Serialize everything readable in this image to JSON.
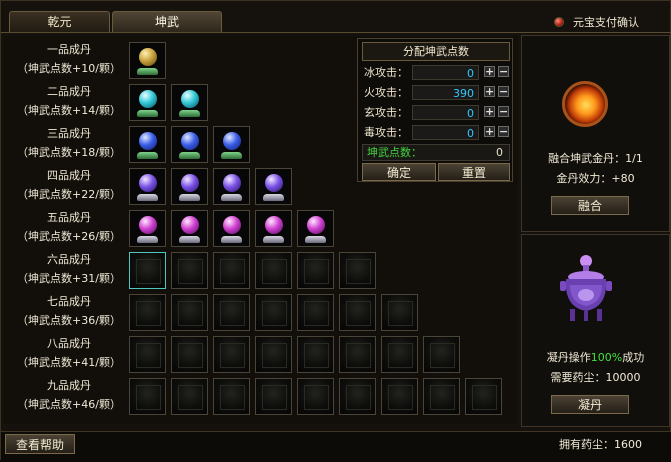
{
  "tabs": {
    "qianyuan": "乾元",
    "kunwu": "坤武"
  },
  "pay": {
    "label": "元宝支付确认",
    "checked": false
  },
  "rows": [
    {
      "name": "一品成丹",
      "sub": "（坤武点数+10/颗）",
      "filled": 1,
      "total": 1,
      "orb": "gold",
      "pedestal": "green"
    },
    {
      "name": "二品成丹",
      "sub": "（坤武点数+14/颗）",
      "filled": 2,
      "total": 2,
      "orb": "cyan",
      "pedestal": "green"
    },
    {
      "name": "三品成丹",
      "sub": "（坤武点数+18/颗）",
      "filled": 3,
      "total": 3,
      "orb": "blue",
      "pedestal": "green"
    },
    {
      "name": "四品成丹",
      "sub": "（坤武点数+22/颗）",
      "filled": 4,
      "total": 4,
      "orb": "violet",
      "pedestal": "silver"
    },
    {
      "name": "五品成丹",
      "sub": "（坤武点数+26/颗）",
      "filled": 5,
      "total": 5,
      "orb": "pink",
      "pedestal": "silver"
    },
    {
      "name": "六品成丹",
      "sub": "（坤武点数+31/颗）",
      "filled": 0,
      "total": 6,
      "orb": "",
      "pedestal": ""
    },
    {
      "name": "七品成丹",
      "sub": "（坤武点数+36/颗）",
      "filled": 0,
      "total": 7,
      "orb": "",
      "pedestal": ""
    },
    {
      "name": "八品成丹",
      "sub": "（坤武点数+41/颗）",
      "filled": 0,
      "total": 8,
      "orb": "",
      "pedestal": ""
    },
    {
      "name": "九品成丹",
      "sub": "（坤武点数+46/颗）",
      "filled": 0,
      "total": 9,
      "orb": "",
      "pedestal": ""
    }
  ],
  "distribution": {
    "title": "分配坤武点数",
    "attacks": [
      {
        "label": "冰攻击：",
        "value": "0"
      },
      {
        "label": "火攻击：",
        "value": "390"
      },
      {
        "label": "玄攻击：",
        "value": "0"
      },
      {
        "label": "毒攻击：",
        "value": "0"
      }
    ],
    "plus": "+",
    "minus": "−",
    "points_label": "坤武点数：",
    "points_value": "0",
    "confirm": "确定",
    "reset": "重置"
  },
  "fuse": {
    "line1": "融合坤武金丹：1/1",
    "line2": "金丹效力：+80",
    "button": "融合"
  },
  "condense": {
    "op_prefix": "凝丹操作",
    "op_rate": "100%",
    "op_suffix": "成功",
    "cost": "需要药尘：10000",
    "button": "凝丹"
  },
  "footer": {
    "help": "查看帮助",
    "dust": "拥有药尘：1600"
  },
  "colors": {
    "accent_green": "#3ee23a",
    "value_cyan": "#2ec8ff",
    "selected_slot": "#4fc7c0"
  }
}
